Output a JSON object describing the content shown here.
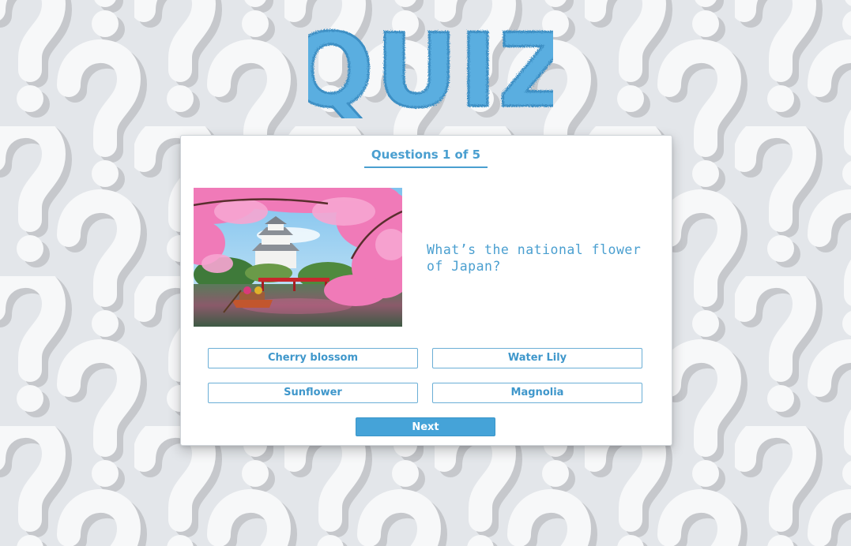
{
  "header": {
    "logo_text": "QUIZ"
  },
  "quiz": {
    "counter": "Questions 1 of 5",
    "question": "What’s the national flower of Japan?",
    "image": {
      "name": "japan-cherry-blossom-photo"
    },
    "answers": [
      {
        "label": "Cherry blossom"
      },
      {
        "label": "Water Lily"
      },
      {
        "label": "Sunflower"
      },
      {
        "label": "Magnolia"
      }
    ],
    "next_label": "Next"
  },
  "colors": {
    "accent": "#4a9fd0",
    "button": "#45a3d8",
    "logo": "#5aaee0",
    "background": "#e4e7eb",
    "card": "#ffffff"
  },
  "icons": {
    "background_pattern": "question-mark-icon"
  }
}
